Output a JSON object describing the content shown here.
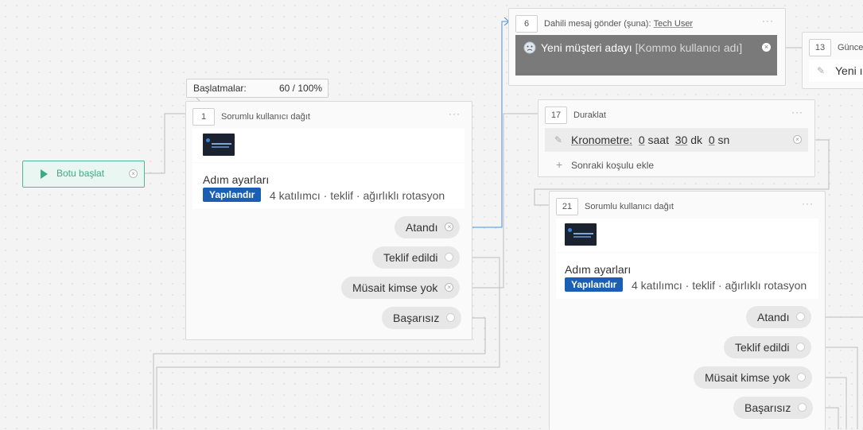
{
  "start": {
    "label": "Botu başlat"
  },
  "stats": {
    "label": "Başlatmalar:",
    "value": "60 / 100%"
  },
  "step1": {
    "number": "1",
    "title": "Sorumlu kullanıcı dağıt",
    "settings_title": "Adım ayarları",
    "badge": "Yapılandır",
    "description": "4 katılımcı · teklif · ağırlıklı rotasyon",
    "outputs": [
      "Atandı",
      "Teklif edildi",
      "Müsait kimse yok",
      "Başarısız"
    ]
  },
  "step6": {
    "number": "6",
    "title_prefix": "Dahili mesaj gönder (şuna): ",
    "title_user": "Tech User",
    "message_text": "Yeni müşteri adayı",
    "message_var": "[Kommo kullanıcı adı]"
  },
  "step13": {
    "number": "13",
    "title": "Günce",
    "text": "Yeni ı"
  },
  "step17": {
    "number": "17",
    "title": "Duraklat",
    "timer_label": "Kronometre:",
    "hours": "0",
    "hours_unit": "saat",
    "minutes": "30",
    "minutes_unit": "dk",
    "seconds": "0",
    "seconds_unit": "sn",
    "add_condition": "Sonraki koşulu ekle"
  },
  "step21": {
    "number": "21",
    "title": "Sorumlu kullanıcı dağıt",
    "settings_title": "Adım ayarları",
    "badge": "Yapılandır",
    "description": "4 katılımcı · teklif · ağırlıklı rotasyon",
    "outputs": [
      "Atandı",
      "Teklif edildi",
      "Müsait kimse yok",
      "Başarısız"
    ]
  },
  "colors": {
    "accent": "#1a5fb4",
    "start": "#3fa985",
    "wire_active": "#4a90d9",
    "wire": "#bdbdbd"
  }
}
